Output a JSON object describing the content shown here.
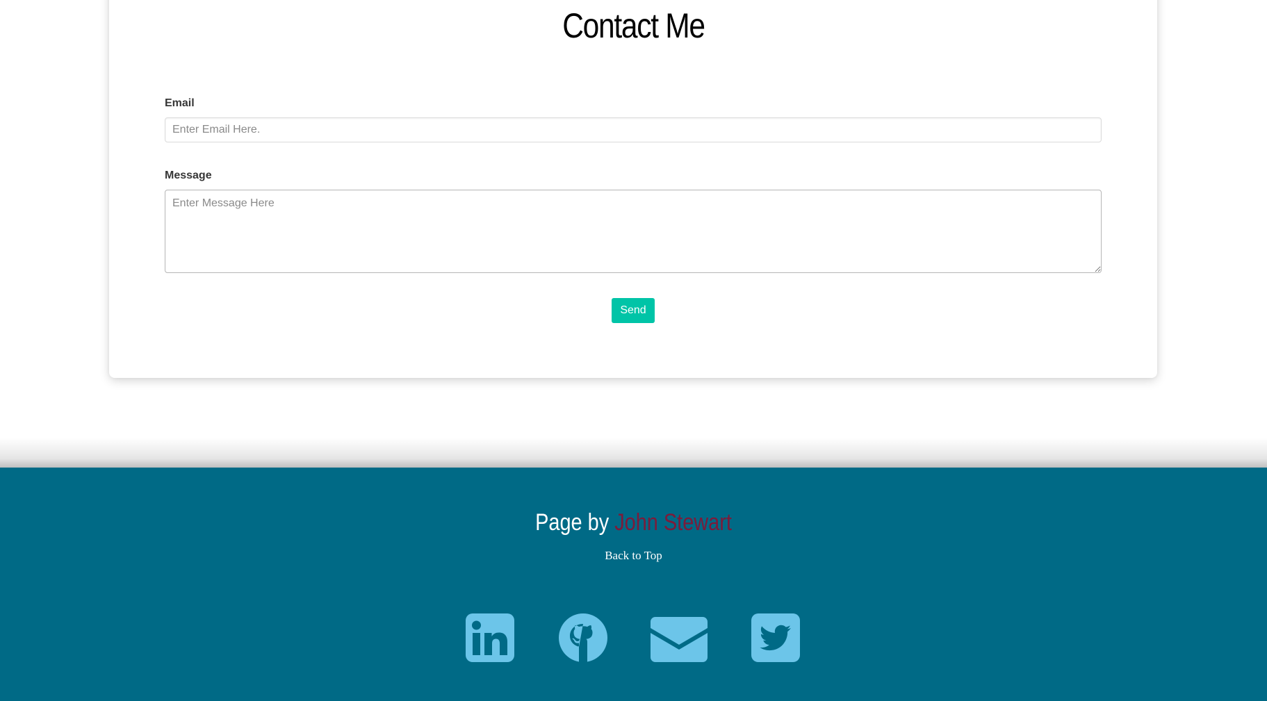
{
  "contact": {
    "title": "Contact Me",
    "email_label": "Email",
    "email_placeholder": "Enter Email Here.",
    "email_value": "",
    "message_label": "Message",
    "message_placeholder": "Enter Message Here",
    "message_value": "",
    "send_label": "Send"
  },
  "footer": {
    "credit_prefix": "Page by",
    "author_name": "John Stewart",
    "back_to_top": "Back to Top",
    "social_icons": [
      "linkedin-icon",
      "github-icon",
      "envelope-icon",
      "twitter-icon"
    ]
  },
  "colors": {
    "accent": "#00c4a7",
    "footer_bg": "#006a86",
    "author_name": "#7c1b3a",
    "icon": "#6cc5e9"
  }
}
